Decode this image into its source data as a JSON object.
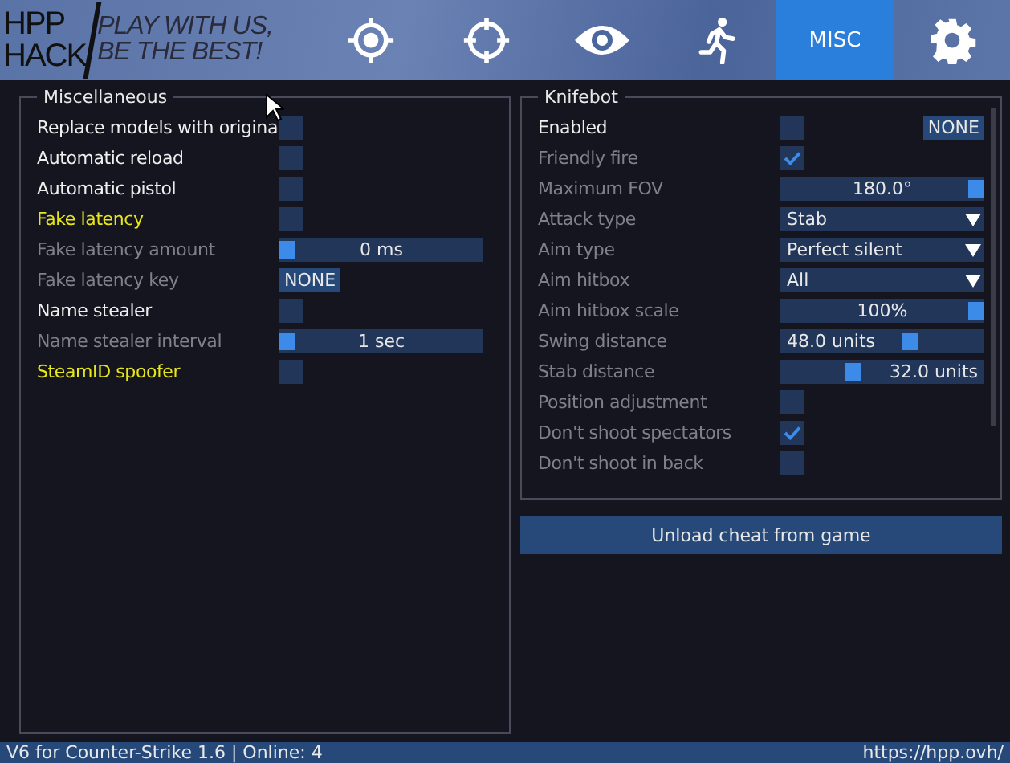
{
  "logo": {
    "title_top": "HPP",
    "title_bottom": "HACK",
    "slogan_top": "PLAY WITH US,",
    "slogan_bottom": "BE THE BEST!"
  },
  "tabs": [
    {
      "kind": "target",
      "selected": false
    },
    {
      "kind": "crosshair",
      "selected": false
    },
    {
      "kind": "eye",
      "selected": false
    },
    {
      "kind": "runner",
      "selected": false
    },
    {
      "kind": "text",
      "label": "MISC",
      "selected": true
    },
    {
      "kind": "gear",
      "selected": false
    }
  ],
  "misc_group": {
    "title": "Miscellaneous",
    "rows": [
      {
        "kind": "checkbox",
        "label": "Replace models with origina",
        "disabled": false,
        "highlighted": false,
        "checked": false
      },
      {
        "kind": "checkbox",
        "label": "Automatic reload",
        "disabled": false,
        "highlighted": false,
        "checked": false
      },
      {
        "kind": "checkbox",
        "label": "Automatic pistol",
        "disabled": false,
        "highlighted": false,
        "checked": false
      },
      {
        "kind": "checkbox",
        "label": "Fake latency",
        "disabled": false,
        "highlighted": true,
        "checked": false
      },
      {
        "kind": "slider",
        "label": "Fake latency amount",
        "disabled": true,
        "highlighted": false,
        "level": 0,
        "reading": "0 ms"
      },
      {
        "kind": "key",
        "label": "Fake latency key",
        "disabled": true,
        "highlighted": false,
        "key": "NONE"
      },
      {
        "kind": "checkbox",
        "label": "Name stealer",
        "disabled": false,
        "highlighted": false,
        "checked": false
      },
      {
        "kind": "slider",
        "label": "Name stealer interval",
        "disabled": true,
        "highlighted": false,
        "level": 0,
        "reading": "1 sec"
      },
      {
        "kind": "checkbox",
        "label": "SteamID spoofer",
        "disabled": false,
        "highlighted": true,
        "checked": false
      }
    ]
  },
  "knifebot_group": {
    "title": "Knifebot",
    "rows": [
      {
        "kind": "checkbox_key",
        "label": "Enabled",
        "disabled": false,
        "highlighted": false,
        "checked": false,
        "key": "NONE"
      },
      {
        "kind": "checkbox",
        "label": "Friendly fire",
        "disabled": true,
        "highlighted": false,
        "checked": true
      },
      {
        "kind": "slider",
        "label": "Maximum FOV",
        "disabled": true,
        "highlighted": false,
        "level": 1,
        "reading": "180.0°"
      },
      {
        "kind": "dropdown",
        "label": "Attack type",
        "disabled": true,
        "highlighted": false,
        "value": "Stab"
      },
      {
        "kind": "dropdown",
        "label": "Aim type",
        "disabled": true,
        "highlighted": false,
        "value": "Perfect silent"
      },
      {
        "kind": "dropdown",
        "label": "Aim hitbox",
        "disabled": true,
        "highlighted": false,
        "value": "All"
      },
      {
        "kind": "slider",
        "label": "Aim hitbox scale",
        "disabled": true,
        "highlighted": false,
        "level": 1,
        "reading": "100%"
      },
      {
        "kind": "slider",
        "label": "Swing distance",
        "disabled": true,
        "highlighted": false,
        "level": 0.65,
        "reading": "48.0 units"
      },
      {
        "kind": "slider",
        "label": "Stab distance",
        "disabled": true,
        "highlighted": false,
        "level": 0.34,
        "reading": "32.0 units"
      },
      {
        "kind": "checkbox",
        "label": "Position adjustment",
        "disabled": true,
        "highlighted": false,
        "checked": false
      },
      {
        "kind": "checkbox",
        "label": "Don't shoot spectators",
        "disabled": true,
        "highlighted": false,
        "checked": true
      },
      {
        "kind": "checkbox",
        "label": "Don't shoot in back",
        "disabled": true,
        "highlighted": false,
        "checked": false
      }
    ]
  },
  "unload_button": "Unload cheat from game",
  "status_bar": {
    "left": "V6 for Counter-Strike 1.6 | Online: 4",
    "right": "https://hpp.ovh/"
  }
}
